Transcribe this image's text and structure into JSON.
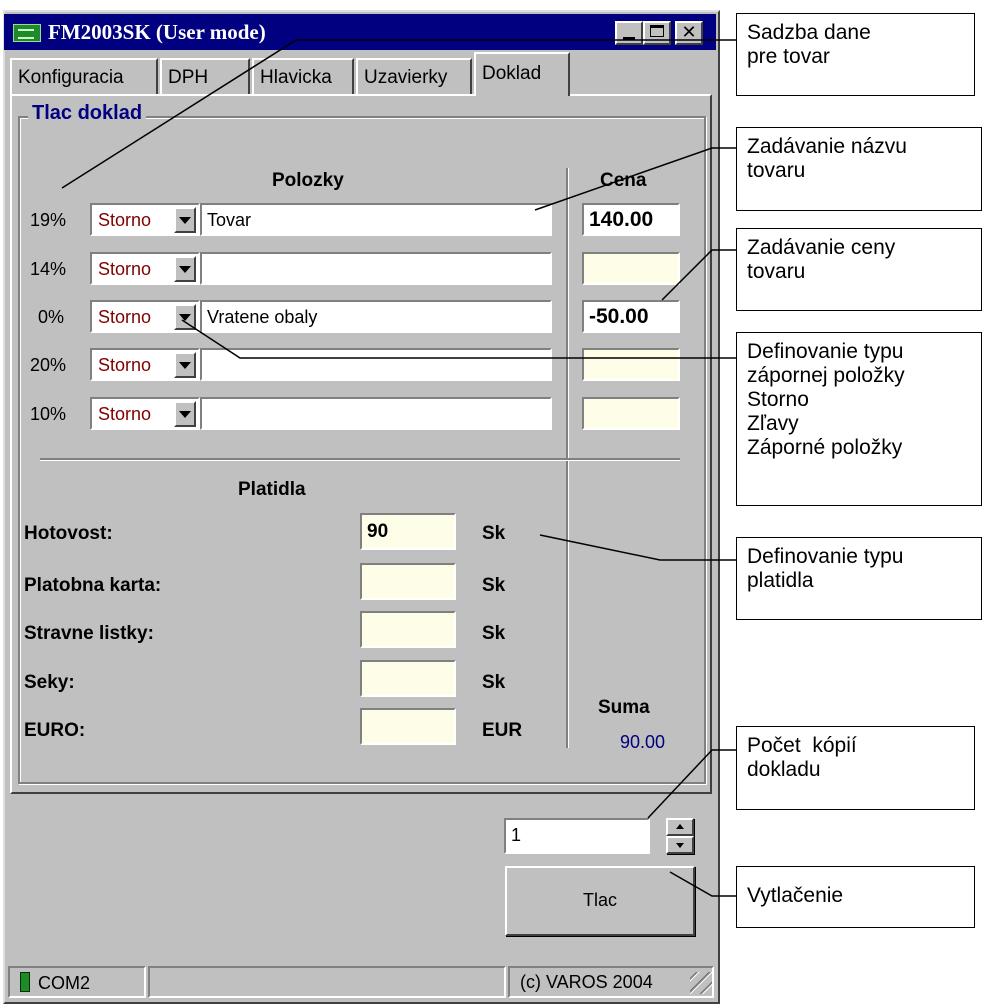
{
  "window": {
    "title": "FM2003SK (User mode)",
    "caption_buttons": {
      "minimize": "",
      "maximize": "",
      "close": "✕"
    }
  },
  "tabs": [
    {
      "label": "Konfiguracia",
      "active": false
    },
    {
      "label": "DPH",
      "active": false
    },
    {
      "label": "Hlavicka",
      "active": false
    },
    {
      "label": "Uzavierky",
      "active": false
    },
    {
      "label": "Doklad",
      "active": true
    }
  ],
  "group_title": "Tlac doklad",
  "items": {
    "header_items": "Polozky",
    "header_price": "Cena",
    "rows": [
      {
        "rate": "19%",
        "type": "Storno",
        "name": "Tovar",
        "price": "140.00"
      },
      {
        "rate": "14%",
        "type": "Storno",
        "name": "",
        "price": ""
      },
      {
        "rate": "0%",
        "type": "Storno",
        "name": "Vratene obaly",
        "price": "-50.00"
      },
      {
        "rate": "20%",
        "type": "Storno",
        "name": "",
        "price": ""
      },
      {
        "rate": "10%",
        "type": "Storno",
        "name": "",
        "price": ""
      }
    ]
  },
  "payments": {
    "header": "Platidla",
    "rows": [
      {
        "label": "Hotovost:",
        "value": "90",
        "unit": "Sk"
      },
      {
        "label": "Platobna karta:",
        "value": "",
        "unit": "Sk"
      },
      {
        "label": "Stravne listky:",
        "value": "",
        "unit": "Sk"
      },
      {
        "label": "Seky:",
        "value": "",
        "unit": "Sk"
      },
      {
        "label": "EURO:",
        "value": "",
        "unit": "EUR"
      }
    ]
  },
  "sum": {
    "label": "Suma",
    "value": "90.00"
  },
  "copies": {
    "value": "1"
  },
  "print_button": "Tlac",
  "statusbar": {
    "port": "COM2",
    "copyright": "(c) VAROS 2004"
  },
  "callouts": {
    "tax_rate": [
      "Sadzba dane",
      "pre tovar"
    ],
    "item_name": [
      "Zadávanie názvu",
      "tovaru"
    ],
    "item_price": [
      "Zadávanie ceny",
      "tovaru"
    ],
    "negative_type": [
      "Definovanie typu",
      "zápornej položky",
      "Storno",
      "Zľavy",
      "Záporné položky"
    ],
    "payment_type": [
      "Definovanie typu",
      "platidla"
    ],
    "copies": [
      "Počet  kópií",
      "dokladu"
    ],
    "print": [
      "Vytlačenie"
    ]
  },
  "colors": {
    "titlebar": "#000080",
    "window_face": "#c0c0c0",
    "field_empty": "#fdfde8",
    "combo_text": "#800000",
    "group_label": "#000080",
    "sum_value": "#000080"
  }
}
